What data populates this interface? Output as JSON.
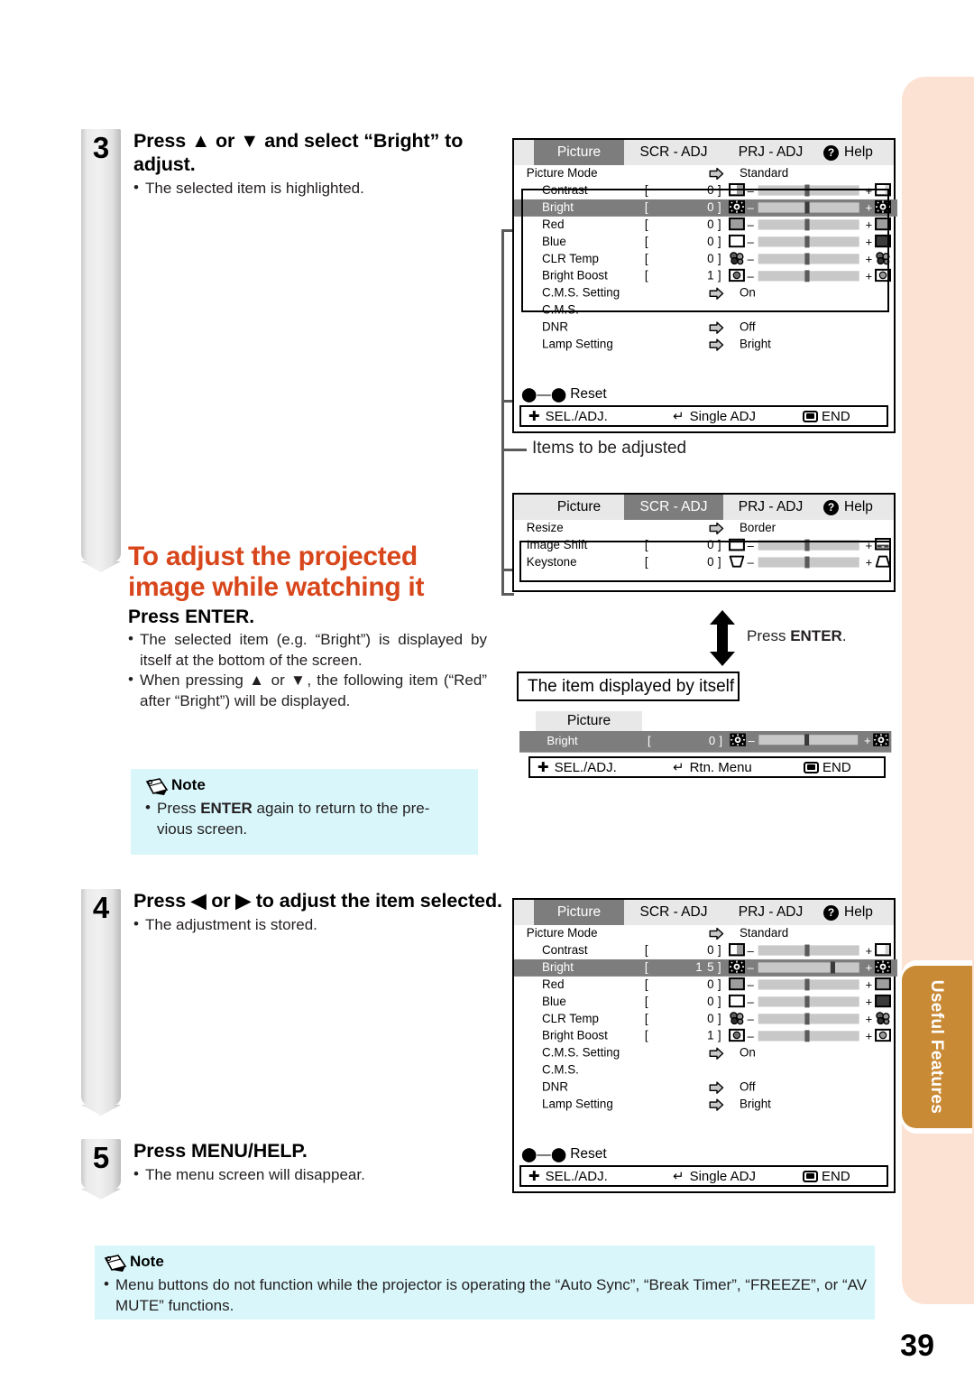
{
  "page": {
    "number": "39",
    "chapter_tab": "Useful Features"
  },
  "steps": [
    {
      "num": "3",
      "title": "Press ▲ or ▼ and select “Bright” to adjust.",
      "bullets": [
        "The selected item is highlighted."
      ]
    },
    {
      "num": "4",
      "title": "Press ◀ or ▶ to adjust the item selected.",
      "bullets": [
        "The adjustment is stored."
      ]
    },
    {
      "num": "5",
      "title_plain": "Press ",
      "title_bold": "MENU/HELP.",
      "bullets": [
        "The menu screen will disappear."
      ]
    }
  ],
  "section": {
    "heading_line1": "To adjust the projected",
    "heading_line2": "image while watching it",
    "subheading_plain": "Press ",
    "subheading_bold": "ENTER.",
    "bullets": [
      "The selected item (e.g. “Bright”) is displayed by itself at the bottom of the screen.",
      "When pressing ▲ or ▼, the following item (“Red” after “Bright”) will be displayed."
    ]
  },
  "note_top": {
    "label": "Note",
    "bullets": [
      "Press ENTER again to return to the previous screen."
    ],
    "bullet_bold": "ENTER"
  },
  "note_bottom": {
    "label": "Note",
    "bullets": [
      "Menu buttons do not function while the projector is operating the “Auto Sync”, “Break Timer”, “FREEZE”, or “AV MUTE” functions."
    ]
  },
  "callouts": {
    "items_to_be_adjusted": "Items to be adjusted",
    "press_enter": "Press ENTER.",
    "press_enter_plain": "Press ",
    "press_enter_bold": "ENTER",
    "item_displayed_by_itself": "The item displayed by itself"
  },
  "osd_common": {
    "tabs": [
      "Picture",
      "SCR - ADJ",
      "PRJ - ADJ"
    ],
    "help_label": "Help",
    "help_icon": "question-mark-icon",
    "footer": {
      "sel_adj": "SEL./ADJ.",
      "single_adj": "Single ADJ",
      "rtn_menu": "Rtn. Menu",
      "end": "END"
    },
    "reset_label": "Reset",
    "minus": "–",
    "plus": "+",
    "bracket_left": "[",
    "bracket_right": "]"
  },
  "osd_menu_1": {
    "selected_tab": "Picture",
    "rows": [
      {
        "name": "Picture Mode",
        "type": "arrow",
        "value": "Standard",
        "indent": false
      },
      {
        "name": "Contrast",
        "type": "slider",
        "value": "0",
        "pos": 48,
        "icon": "contrast-icon",
        "indent": true
      },
      {
        "name": "Bright",
        "type": "slider",
        "value": "0",
        "pos": 48,
        "icon": "bright-icon",
        "indent": true,
        "highlight": true
      },
      {
        "name": "Red",
        "type": "slider",
        "value": "0",
        "pos": 48,
        "icon": "red-icon",
        "indent": true
      },
      {
        "name": "Blue",
        "type": "slider",
        "value": "0",
        "pos": 48,
        "icon": "blue-icon",
        "indent": true
      },
      {
        "name": "CLR Temp",
        "type": "slider",
        "value": "0",
        "pos": 48,
        "icon": "clr-temp-icon",
        "indent": true
      },
      {
        "name": "Bright Boost",
        "type": "slider",
        "value": "1",
        "pos": 48,
        "icon": "bright-boost-icon",
        "indent": true
      },
      {
        "name": "C.M.S. Setting",
        "type": "arrow",
        "value": "On",
        "indent": true
      },
      {
        "name": "C.M.S.",
        "type": "plain",
        "value": "",
        "indent": true
      },
      {
        "name": "DNR",
        "type": "arrow",
        "value": "Off",
        "indent": true
      },
      {
        "name": "Lamp Setting",
        "type": "arrow",
        "value": "Bright",
        "indent": true
      }
    ]
  },
  "osd_menu_2": {
    "selected_tab": "SCR - ADJ",
    "rows": [
      {
        "name": "Resize",
        "type": "arrow",
        "value": "Border",
        "indent": false
      },
      {
        "name": "Image Shift",
        "type": "slider",
        "value": "0",
        "pos": 48,
        "icon": "image-shift-icon",
        "indent": false
      },
      {
        "name": "Keystone",
        "type": "slider",
        "value": "0",
        "pos": 48,
        "icon": "keystone-icon",
        "indent": false
      }
    ]
  },
  "osd_single": {
    "tab": "Picture",
    "row": {
      "name": "Bright",
      "value": "0",
      "pos": 48,
      "icon": "bright-icon"
    }
  },
  "osd_menu_3": {
    "selected_tab": "Picture",
    "rows": [
      {
        "name": "Picture Mode",
        "type": "arrow",
        "value": "Standard",
        "indent": false
      },
      {
        "name": "Contrast",
        "type": "slider",
        "value": "0",
        "pos": 48,
        "icon": "contrast-icon",
        "indent": true
      },
      {
        "name": "Bright",
        "type": "slider",
        "value": "1 5",
        "pos": 75,
        "icon": "bright-icon",
        "indent": true,
        "highlight": true
      },
      {
        "name": "Red",
        "type": "slider",
        "value": "0",
        "pos": 48,
        "icon": "red-icon",
        "indent": true
      },
      {
        "name": "Blue",
        "type": "slider",
        "value": "0",
        "pos": 48,
        "icon": "blue-icon",
        "indent": true
      },
      {
        "name": "CLR Temp",
        "type": "slider",
        "value": "0",
        "pos": 48,
        "icon": "clr-temp-icon",
        "indent": true
      },
      {
        "name": "Bright Boost",
        "type": "slider",
        "value": "1",
        "pos": 48,
        "icon": "bright-boost-icon",
        "indent": true
      },
      {
        "name": "C.M.S. Setting",
        "type": "arrow",
        "value": "On",
        "indent": true
      },
      {
        "name": "C.M.S.",
        "type": "plain",
        "value": "",
        "indent": true
      },
      {
        "name": "DNR",
        "type": "arrow",
        "value": "Off",
        "indent": true
      },
      {
        "name": "Lamp Setting",
        "type": "arrow",
        "value": "Bright",
        "indent": true
      }
    ]
  },
  "colors": {
    "accent_orange": "#d8461b",
    "note_blue": "#d9f7fb",
    "tab_brown": "#c98a36",
    "band_peach": "#fbe2d3"
  }
}
